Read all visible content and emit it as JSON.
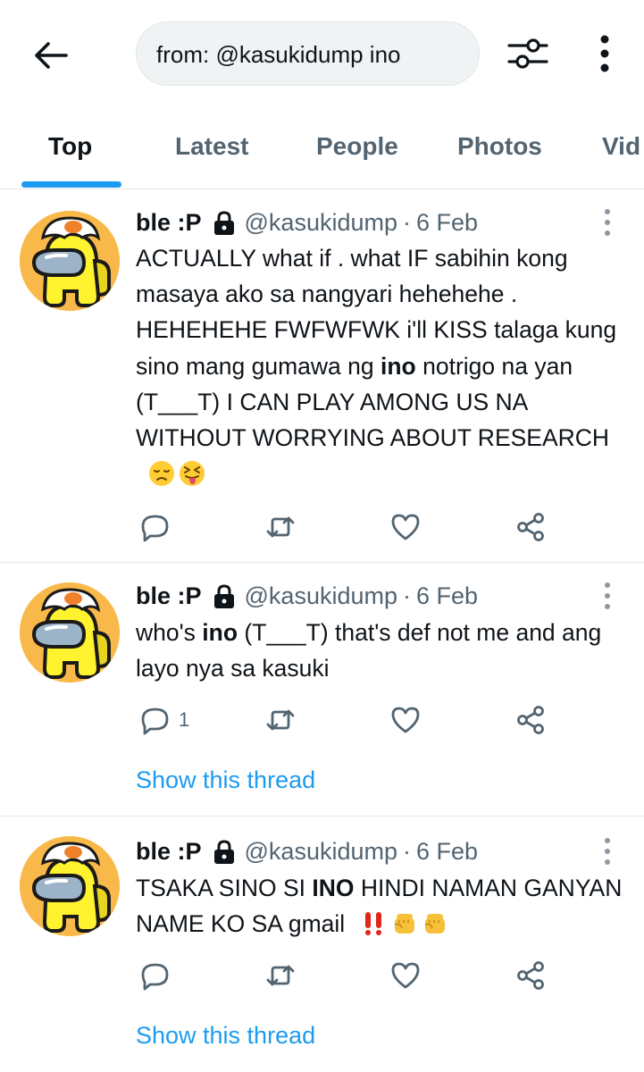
{
  "search": {
    "query": "from: @kasukidump ino"
  },
  "tabs": [
    {
      "label": "Top",
      "active": true
    },
    {
      "label": "Latest"
    },
    {
      "label": "People"
    },
    {
      "label": "Photos"
    },
    {
      "label": "Vid"
    }
  ],
  "colors": {
    "accent": "#1d9bf0",
    "secondary_text": "#536471",
    "divider": "#e1e6e9"
  },
  "tweets": [
    {
      "name": "ble :P",
      "handle": "@kasukidump",
      "dot": "·",
      "date": "6 Feb",
      "text_parts": [
        "ACTUALLY what if . what IF sabihin kong masaya ako sa nangyari hehehehe . HEHEHEHE FWFWFWK i'll KISS talaga kung sino mang gumawa ng ",
        "ino",
        " notrigo na yan (T___T) I CAN PLAY AMONG US NA WITHOUT WORRYING ABOUT RESEARCH "
      ],
      "emojis": [
        "disappointed-face-emoji",
        "squinting-tongue-face-emoji"
      ],
      "reply_count": "",
      "show_thread": ""
    },
    {
      "name": "ble :P",
      "handle": "@kasukidump",
      "dot": "·",
      "date": "6 Feb",
      "text_parts": [
        "who's ",
        "ino",
        " (T___T) that's def not me and ang layo nya sa kasuki"
      ],
      "emojis": [],
      "reply_count": "1",
      "show_thread": "Show this thread"
    },
    {
      "name": "ble :P",
      "handle": "@kasukidump",
      "dot": "·",
      "date": "6 Feb",
      "text_parts": [
        "TSAKA SINO SI ",
        "INO",
        " HINDI NAMAN GANYAN NAME KO SA gmail "
      ],
      "emojis": [
        "double-exclamation-emoji",
        "fist-bump-emoji",
        "fist-bump-emoji"
      ],
      "reply_count": "",
      "show_thread": "Show this thread"
    }
  ],
  "icons": {
    "back": "arrow-left-icon",
    "filter": "sliders-icon",
    "more": "vertical-dots-icon",
    "lock": "lock-icon",
    "reply": "reply-icon",
    "retweet": "retweet-icon",
    "like": "heart-icon",
    "share": "share-icon"
  }
}
